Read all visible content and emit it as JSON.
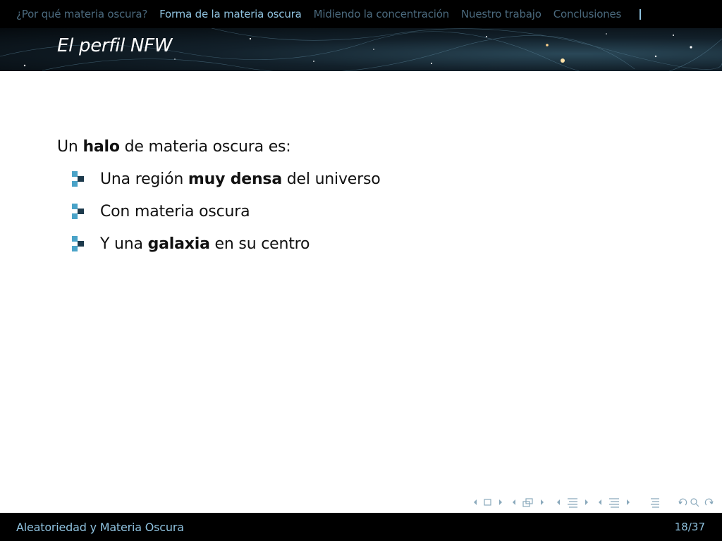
{
  "nav": {
    "sections": [
      {
        "label": "¿Por qué materia oscura?",
        "active": false
      },
      {
        "label": "Forma de la materia oscura",
        "active": true
      },
      {
        "label": "Midiendo la concentración",
        "active": false
      },
      {
        "label": "Nuestro trabajo",
        "active": false
      },
      {
        "label": "Conclusiones",
        "active": false
      }
    ]
  },
  "slide": {
    "title": "El perfil NFW",
    "intro": {
      "pre": "Un ",
      "bold": "halo",
      "post": " de materia oscura es:"
    },
    "items": [
      {
        "pre": "Una región ",
        "bold": "muy densa",
        "post": " del universo"
      },
      {
        "pre": "Con materia oscura",
        "bold": "",
        "post": ""
      },
      {
        "pre": "Y una ",
        "bold": "galaxia",
        "post": " en su centro"
      }
    ]
  },
  "beamer_nav_icons": [
    "slide-prev-next",
    "frame-prev-next",
    "subsection-prev-next",
    "section-prev-next",
    "toc",
    "back-search-forward"
  ],
  "footer": {
    "title": "Aleatoriedad y Materia Oscura",
    "page": "18/37"
  },
  "colors": {
    "nav_active": "#8fc2df",
    "nav_inactive": "#4b6a7e",
    "bullet_light": "#4aa3c8",
    "bullet_dark": "#1d3a4c",
    "footer_text": "#8fc2df"
  }
}
